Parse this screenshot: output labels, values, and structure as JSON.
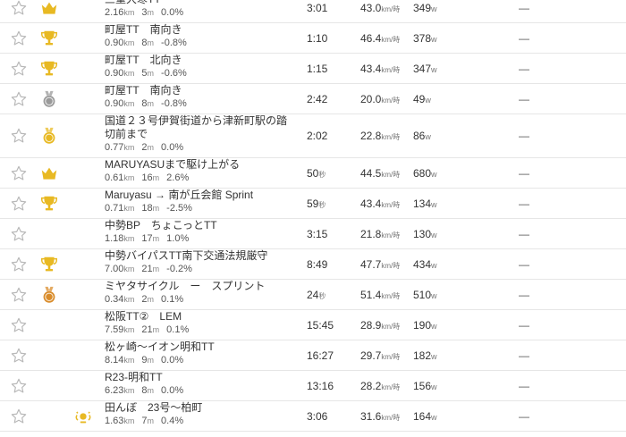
{
  "colors": {
    "gold": "#e8b923",
    "silver": "#9a9a9a",
    "bronze": "#d98c2b",
    "star_outline": "#b8b8b8"
  },
  "rows": [
    {
      "name": "三重大寒TT",
      "distance": "2.16",
      "distance_unit": "km",
      "elevation": "3",
      "elevation_unit": "m",
      "grade": "0.0%",
      "time": "3:01",
      "time_unit": "",
      "speed": "43.0",
      "speed_unit": "km/時",
      "power": "349",
      "power_unit": "w",
      "rank": "—",
      "medal": "crown-icon"
    },
    {
      "name": "町屋TT　南向き",
      "distance": "0.90",
      "distance_unit": "km",
      "elevation": "8",
      "elevation_unit": "m",
      "grade": "-0.8%",
      "time": "1:10",
      "time_unit": "",
      "speed": "46.4",
      "speed_unit": "km/時",
      "power": "378",
      "power_unit": "w",
      "rank": "—",
      "medal": "trophy-icon"
    },
    {
      "name": "町屋TT　北向き",
      "distance": "0.90",
      "distance_unit": "km",
      "elevation": "5",
      "elevation_unit": "m",
      "grade": "-0.6%",
      "time": "1:15",
      "time_unit": "",
      "speed": "43.4",
      "speed_unit": "km/時",
      "power": "347",
      "power_unit": "w",
      "rank": "—",
      "medal": "trophy-icon"
    },
    {
      "name": "町屋TT　南向き",
      "distance": "0.90",
      "distance_unit": "km",
      "elevation": "8",
      "elevation_unit": "m",
      "grade": "-0.8%",
      "time": "2:42",
      "time_unit": "",
      "speed": "20.0",
      "speed_unit": "km/時",
      "power": "49",
      "power_unit": "w",
      "rank": "—",
      "medal": "silver-medal-icon"
    },
    {
      "name": "国道２３号伊賀街道から津新町駅の踏切前まで",
      "distance": "0.77",
      "distance_unit": "km",
      "elevation": "2",
      "elevation_unit": "m",
      "grade": "0.0%",
      "time": "2:02",
      "time_unit": "",
      "speed": "22.8",
      "speed_unit": "km/時",
      "power": "86",
      "power_unit": "w",
      "rank": "—",
      "medal": "gold-medal-icon"
    },
    {
      "name": "MARUYASUまで駆け上がる",
      "distance": "0.61",
      "distance_unit": "km",
      "elevation": "16",
      "elevation_unit": "m",
      "grade": "2.6%",
      "time": "50",
      "time_unit": "秒",
      "speed": "44.5",
      "speed_unit": "km/時",
      "power": "680",
      "power_unit": "w",
      "rank": "—",
      "medal": "crown-icon"
    },
    {
      "name": "Maruyasu → 南が丘会館 Sprint",
      "distance": "0.71",
      "distance_unit": "km",
      "elevation": "18",
      "elevation_unit": "m",
      "grade": "-2.5%",
      "time": "59",
      "time_unit": "秒",
      "speed": "43.4",
      "speed_unit": "km/時",
      "power": "134",
      "power_unit": "w",
      "rank": "—",
      "medal": "trophy-icon"
    },
    {
      "name": "中勢BP　ちょこっとTT",
      "distance": "1.18",
      "distance_unit": "km",
      "elevation": "17",
      "elevation_unit": "m",
      "grade": "1.0%",
      "time": "3:15",
      "time_unit": "",
      "speed": "21.8",
      "speed_unit": "km/時",
      "power": "130",
      "power_unit": "w",
      "rank": "—",
      "medal": ""
    },
    {
      "name": "中勢バイパスTT南下交通法規厳守",
      "distance": "7.00",
      "distance_unit": "km",
      "elevation": "21",
      "elevation_unit": "m",
      "grade": "-0.2%",
      "time": "8:49",
      "time_unit": "",
      "speed": "47.7",
      "speed_unit": "km/時",
      "power": "434",
      "power_unit": "w",
      "rank": "—",
      "medal": "trophy-icon"
    },
    {
      "name": "ミヤタサイクル　ー　スプリント",
      "distance": "0.34",
      "distance_unit": "km",
      "elevation": "2",
      "elevation_unit": "m",
      "grade": "0.1%",
      "time": "24",
      "time_unit": "秒",
      "speed": "51.4",
      "speed_unit": "km/時",
      "power": "510",
      "power_unit": "w",
      "rank": "—",
      "medal": "bronze-medal-icon"
    },
    {
      "name": "松阪TT②　LEM",
      "distance": "7.59",
      "distance_unit": "km",
      "elevation": "21",
      "elevation_unit": "m",
      "grade": "0.1%",
      "time": "15:45",
      "time_unit": "",
      "speed": "28.9",
      "speed_unit": "km/時",
      "power": "190",
      "power_unit": "w",
      "rank": "—",
      "medal": ""
    },
    {
      "name": "松ヶ崎〜イオン明和TT",
      "distance": "8.14",
      "distance_unit": "km",
      "elevation": "9",
      "elevation_unit": "m",
      "grade": "0.0%",
      "time": "16:27",
      "time_unit": "",
      "speed": "29.7",
      "speed_unit": "km/時",
      "power": "182",
      "power_unit": "w",
      "rank": "—",
      "medal": ""
    },
    {
      "name": "R23-明和TT",
      "distance": "6.23",
      "distance_unit": "km",
      "elevation": "8",
      "elevation_unit": "m",
      "grade": "0.0%",
      "time": "13:16",
      "time_unit": "",
      "speed": "28.2",
      "speed_unit": "km/時",
      "power": "156",
      "power_unit": "w",
      "rank": "—",
      "medal": ""
    },
    {
      "name": "田んぼ　23号〜柏町",
      "distance": "1.63",
      "distance_unit": "km",
      "elevation": "7",
      "elevation_unit": "m",
      "grade": "0.4%",
      "time": "3:06",
      "time_unit": "",
      "speed": "31.6",
      "speed_unit": "km/時",
      "power": "164",
      "power_unit": "w",
      "rank": "—",
      "medal": "local-legend-icon"
    }
  ]
}
